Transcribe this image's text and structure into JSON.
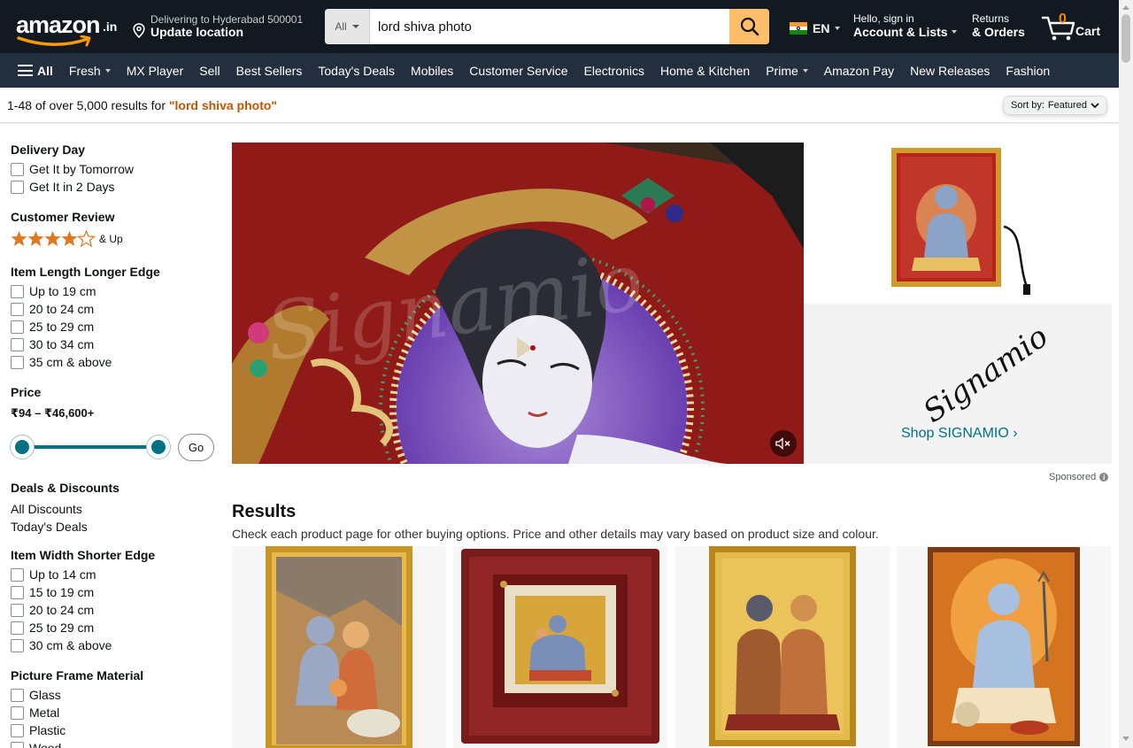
{
  "header": {
    "logo_text": "amazon",
    "logo_tld": ".in",
    "deliver_line1": "Delivering to Hyderabad 500001",
    "deliver_line2": "Update location",
    "search_category": "All",
    "search_query": "lord shiva photo",
    "language": "EN",
    "account_line1": "Hello, sign in",
    "account_line2": "Account & Lists",
    "returns_line1": "Returns",
    "returns_line2": "& Orders",
    "cart_count": "0",
    "cart_label": "Cart"
  },
  "subnav": {
    "all_label": "All",
    "items": [
      "Fresh",
      "MX Player",
      "Sell",
      "Best Sellers",
      "Today's Deals",
      "Mobiles",
      "Customer Service",
      "Electronics",
      "Home & Kitchen",
      "Prime",
      "Amazon Pay",
      "New Releases",
      "Fashion"
    ]
  },
  "results_bar": {
    "prefix": "1-48 of over 5,000 results for ",
    "query": "\"lord shiva photo\"",
    "sort_label": "Sort by:",
    "sort_value": "Featured"
  },
  "sidebar": {
    "delivery_title": "Delivery Day",
    "delivery_options": [
      "Get It by Tomorrow",
      "Get It in 2 Days"
    ],
    "review_title": "Customer Review",
    "review_stars": 4,
    "review_suffix": "& Up",
    "length_title": "Item Length Longer Edge",
    "length_options": [
      "Up to 19 cm",
      "20 to 24 cm",
      "25 to 29 cm",
      "30 to 34 cm",
      "35 cm & above"
    ],
    "price_title": "Price",
    "price_range": "₹94 – ₹46,600+",
    "go_label": "Go",
    "deals_title": "Deals & Discounts",
    "deals_links": [
      "All Discounts",
      "Today's Deals"
    ],
    "width_title": "Item Width Shorter Edge",
    "width_options": [
      "Up to 14 cm",
      "15 to 19 cm",
      "20 to 24 cm",
      "25 to 29 cm",
      "30 cm & above"
    ],
    "material_title": "Picture Frame Material",
    "material_options": [
      "Glass",
      "Metal",
      "Plastic",
      "Wood"
    ]
  },
  "banner": {
    "watermark": "Signamio",
    "brand_logo": "Signamio",
    "shop_label": "Shop SIGNAMIO ›",
    "sponsored": "Sponsored"
  },
  "results": {
    "title": "Results",
    "subtitle": "Check each product page for other buying options. Price and other details may vary based on product size and colour."
  },
  "colors": {
    "nav_dark": "#131921",
    "nav_sub": "#232f3e",
    "search_button": "#febd69",
    "accent_orange": "#c45500",
    "link_teal": "#007185",
    "star": "#de7921"
  },
  "icons": [
    "pin-icon",
    "search-icon",
    "india-flag-icon",
    "cart-icon",
    "hamburger-icon",
    "star-icon",
    "mute-icon",
    "info-icon"
  ]
}
